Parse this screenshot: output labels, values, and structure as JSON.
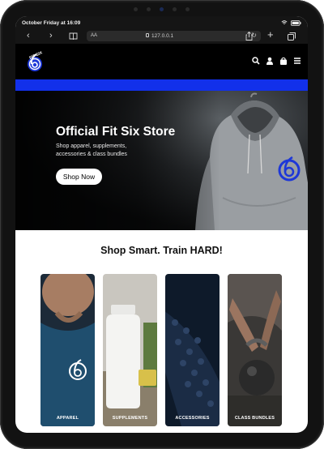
{
  "status_bar": {
    "time": "October Friday at 16:09"
  },
  "browser": {
    "text_size_label": "AA",
    "url": "127.0.0.1"
  },
  "site": {
    "brand_logo_text": "FIT SIX 6"
  },
  "header_icons": [
    "search-icon",
    "account-icon",
    "bag-icon",
    "menu-icon"
  ],
  "hero": {
    "title": "Official Fit Six Store",
    "subtitle": "Shop apparel, supplements, accessories & class bundles",
    "cta_label": "Shop Now"
  },
  "section": {
    "title": "Shop Smart. Train HARD!"
  },
  "categories": [
    {
      "label": "APPAREL"
    },
    {
      "label": "SUPPLEMENTS"
    },
    {
      "label": "ACCESSORIES"
    },
    {
      "label": "CLASS BUNDLES"
    }
  ],
  "colors": {
    "accent_blue": "#1230ea",
    "header_bg": "#000000",
    "device_frame": "#121212"
  }
}
